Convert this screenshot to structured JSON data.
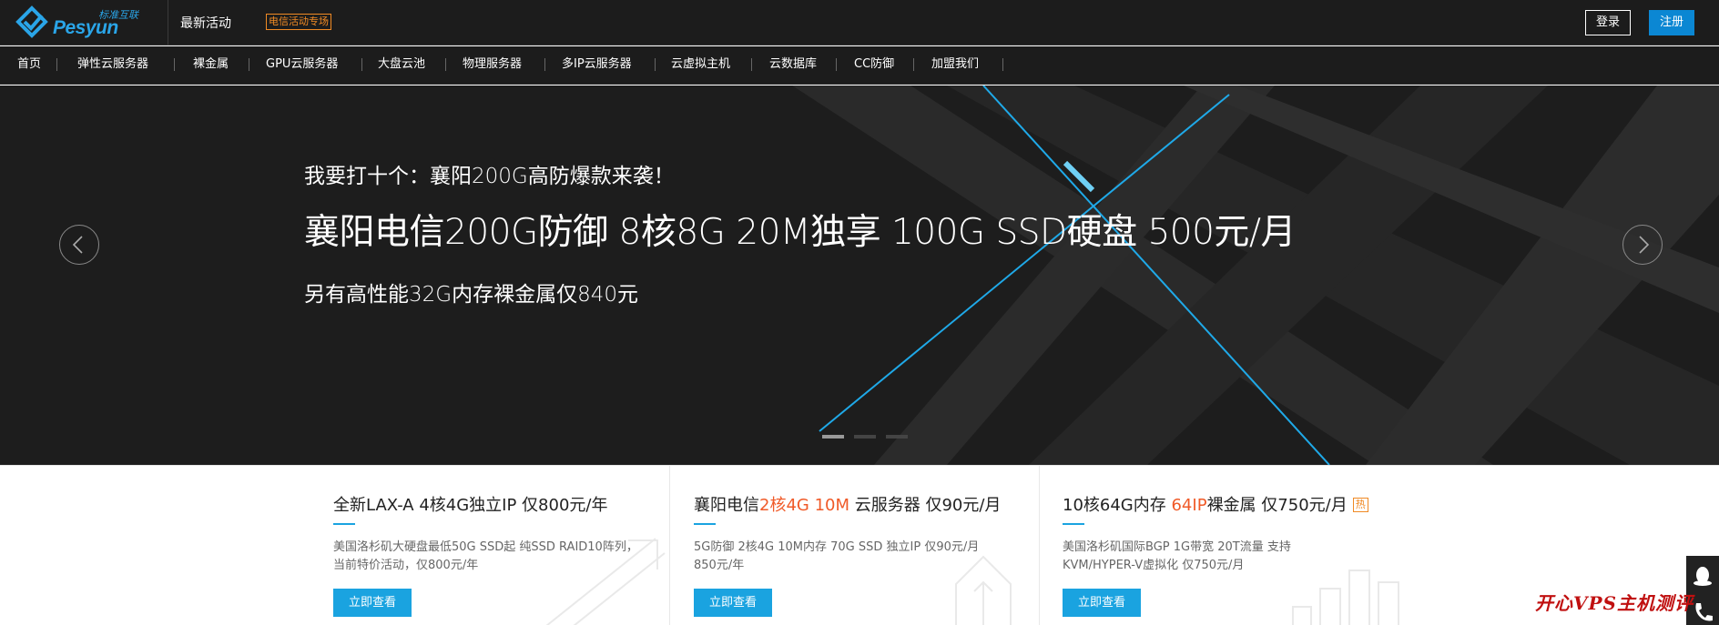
{
  "header": {
    "logo_en": "Pesyun",
    "logo_cn": "标准互联",
    "latest": "最新活动",
    "promo_badge": "电信活动专场",
    "login": "登录",
    "register": "注册"
  },
  "nav": {
    "items": [
      "首页",
      "弹性云服务器",
      "裸金属",
      "GPU云服务器",
      "大盘云池",
      "物理服务器",
      "多IP云服务器",
      "云虚拟主机",
      "云数据库",
      "CC防御",
      "加盟我们"
    ]
  },
  "hero": {
    "line1": "我要打十个：襄阳200G高防爆款来袭！",
    "line2": "襄阳电信200G防御 8核8G 20M独享 100G SSD硬盘 500元/月",
    "line3": "另有高性能32G内存裸金属仅840元",
    "slides": 3,
    "active_slide": 1
  },
  "cards": [
    {
      "title_parts": [
        "全新LAX-A 4核4G独立IP 仅800元/年"
      ],
      "desc": "美国洛杉矶大硬盘最低50G SSD起 纯SSD RAID10阵列，当前特价活动，仅800元/年",
      "button": "立即查看"
    },
    {
      "title_parts": [
        "襄阳电信",
        "2核4G 10M",
        " 云服务器 仅90元/月"
      ],
      "desc": "5G防御 2核4G 10M内存 70G SSD 独立IP 仅90元/月   850元/年",
      "button": "立即查看"
    },
    {
      "title_parts": [
        "10核64G内存 ",
        "64IP",
        "裸金属 仅750元/月"
      ],
      "hot": "热",
      "desc": "美国洛杉矶国际BGP   1G带宽 20T流量 支持KVM/HYPER-V虚拟化 仅750元/月",
      "button": "立即查看"
    }
  ],
  "watermark": "开心VPS主机测评",
  "colors": {
    "accent": "#1aa3e0",
    "highlight": "#f05a28",
    "badge": "#f08a24",
    "dark": "#1c1c1c"
  }
}
